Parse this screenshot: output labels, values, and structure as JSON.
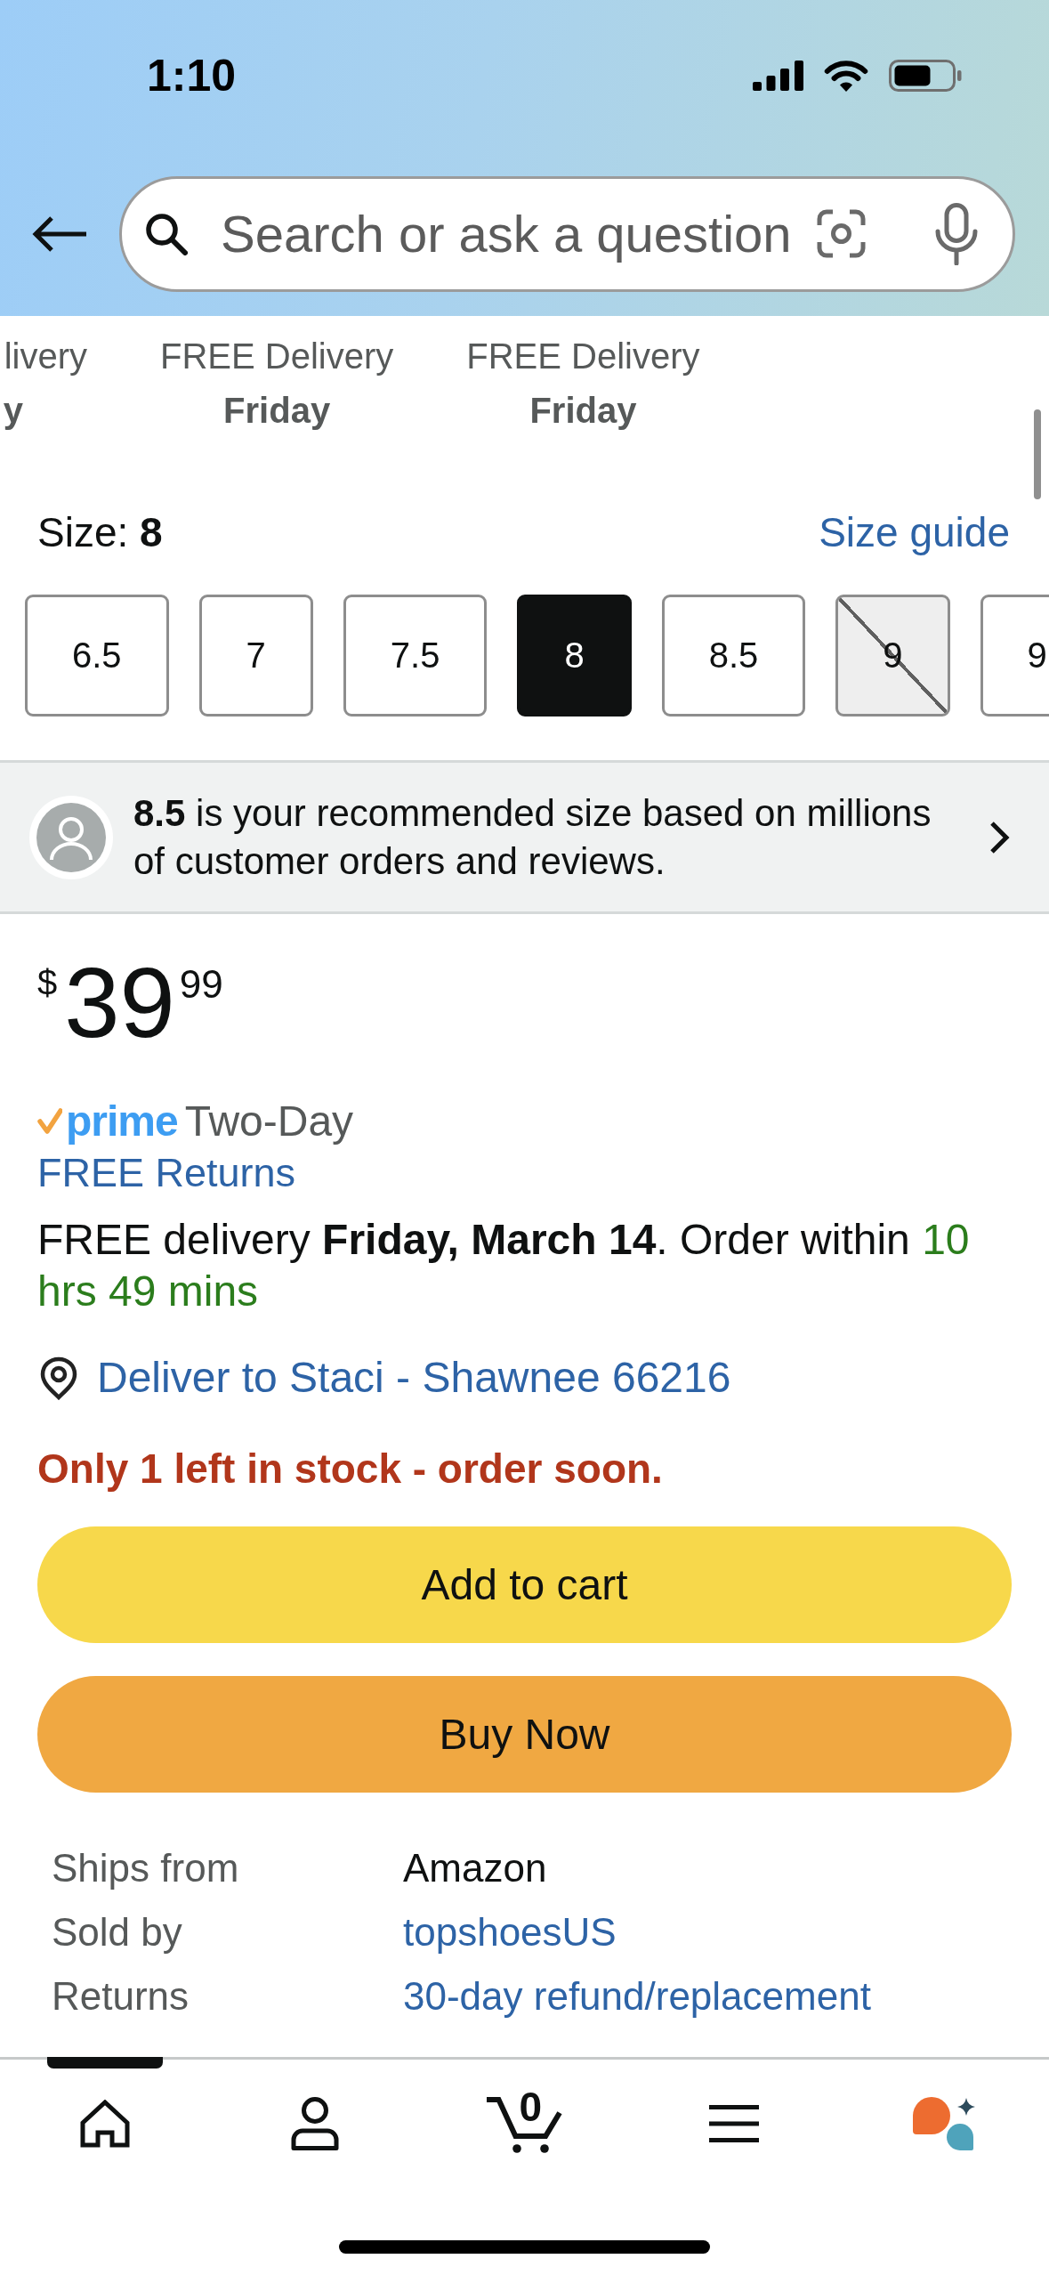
{
  "status_bar": {
    "time": "1:10"
  },
  "search": {
    "placeholder": "Search or ask a question"
  },
  "delivery_options": [
    {
      "label": "livery",
      "day": "y"
    },
    {
      "label": "FREE Delivery",
      "day": "Friday"
    },
    {
      "label": "FREE Delivery",
      "day": "Friday"
    }
  ],
  "size": {
    "label": "Size: **8**",
    "guide_link": "Size guide"
  },
  "sizes": [
    {
      "label": "6.5",
      "selected": false,
      "available": true
    },
    {
      "label": "7",
      "selected": false,
      "available": true
    },
    {
      "label": "7.5",
      "selected": false,
      "available": true
    },
    {
      "label": "8",
      "selected": true,
      "available": true
    },
    {
      "label": "8.5",
      "selected": false,
      "available": true
    },
    {
      "label": "9",
      "selected": false,
      "available": false
    },
    {
      "label": "9",
      "selected": false,
      "available": true
    }
  ],
  "recommendation": {
    "text": "**8.5** is your recommended size based on millions of customer orders and reviews."
  },
  "price": {
    "currency": "$",
    "whole": "39",
    "fraction": "99"
  },
  "prime": {
    "logo": "prime",
    "speed": "Two-Day"
  },
  "returns_link": "FREE Returns",
  "delivery": {
    "text": "FREE delivery **Friday, March 14**. Order within",
    "countdown": "10 hrs 49 mins"
  },
  "deliver_to": "Deliver to Staci - Shawnee 66216",
  "stock_message": "Only 1 left in stock - order soon.",
  "buttons": [
    {
      "label": "Add to cart",
      "kind": "cart"
    },
    {
      "label": "Buy Now",
      "kind": "buy"
    }
  ],
  "details": [
    {
      "label": "Ships from",
      "value": "Amazon",
      "kind": "text"
    },
    {
      "label": "Sold by",
      "value": "topshoesUS",
      "kind": "link"
    },
    {
      "label": "Returns",
      "value": "30-day refund/replacement",
      "kind": "link"
    }
  ],
  "nav": [
    {
      "kind": "home",
      "selected": true
    },
    {
      "kind": "account",
      "selected": false
    },
    {
      "kind": "cart",
      "selected": false,
      "count": "0"
    },
    {
      "kind": "menu",
      "selected": false
    },
    {
      "kind": "assistant",
      "selected": false
    }
  ]
}
